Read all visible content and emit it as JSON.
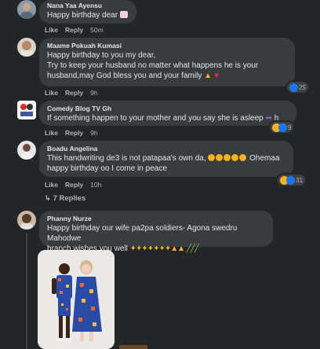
{
  "comments": [
    {
      "author": "Nana Yaa Ayensu",
      "text": "Happy birthday dear",
      "like": "Like",
      "reply": "Reply",
      "time": "50m"
    },
    {
      "author": "Maame Pokuah Kumasi",
      "line1": "Happy birthday to you my dear,",
      "line2": "Try to keep your husband no matter what happens he is your",
      "line3": "husband,may God bless you and your family",
      "like": "Like",
      "reply": "Reply",
      "time": "9h",
      "reaction_count": "25"
    },
    {
      "author": "Comedy Blog TV Gh",
      "text": "If something happen to your mother and you say she is asleep",
      "text_tail": "h",
      "like": "Like",
      "reply": "Reply",
      "time": "9h",
      "reaction_count": "9"
    },
    {
      "author": "Boadu Angelina",
      "line1": "This handwriting de3 is not patapaa's own da,",
      "line1_tail": "Ohemaa",
      "line2": "happy birthday oo I come in peace",
      "like": "Like",
      "reply": "Reply",
      "time": "10h",
      "reaction_count": "31"
    },
    {
      "author": "Phanny Nurze",
      "line1": "Happy birthday our wife pa2pa soldiers- Agona swedru Mahodwe",
      "line2": "branch wishes you well"
    }
  ],
  "replies_link": "7 Replies",
  "colors": {
    "background": "#242526",
    "bubble": "#3a3b3c",
    "text": "#e4e6eb",
    "muted": "#b0b3b8",
    "like_blue": "#1877f2",
    "love_red": "#f33e58"
  }
}
